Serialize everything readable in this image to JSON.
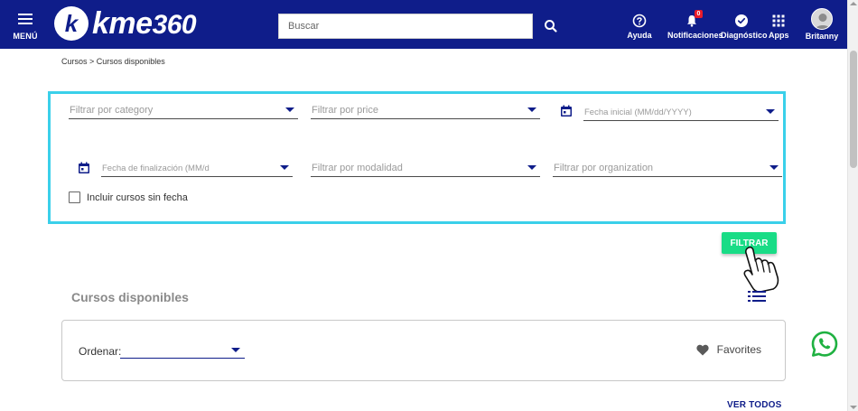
{
  "header": {
    "menu_label": "MENÚ",
    "logo_mark": "k",
    "logo_text": "kme",
    "logo_number": "360",
    "search_placeholder": "Buscar",
    "items": [
      {
        "label": "Ayuda",
        "icon": "help-icon"
      },
      {
        "label": "Notificaciones",
        "icon": "bell-icon",
        "badge": "0"
      },
      {
        "label": "Diagnóstico",
        "icon": "check-circle-icon"
      },
      {
        "label": "Apps",
        "icon": "grid-icon"
      },
      {
        "label": "Britanny",
        "icon": "avatar-icon"
      }
    ],
    "bg_color": "#0f1d8a"
  },
  "breadcrumb": "Cursos > Cursos disponibles",
  "filters": {
    "category_placeholder": "Filtrar por category",
    "price_placeholder": "Filtrar por price",
    "start_date_placeholder": "Fecha inicial (MM/dd/YYYY)",
    "end_date_placeholder": "Fecha de finalización (MM/d",
    "modality_placeholder": "Filtrar por modalidad",
    "organization_placeholder": "Filtrar por organization",
    "include_undated_label": "Incluir cursos sin fecha",
    "include_undated_checked": false,
    "border_color": "#3ad0ea"
  },
  "filter_button": {
    "label": "FILTRAR",
    "color": "#19dc86"
  },
  "section": {
    "title": "Cursos disponibles",
    "sort_label": "Ordenar:",
    "sort_value": "",
    "favorites_label": "Favorites"
  },
  "ver_todos": "VER TODOS",
  "accent_color": "#0f1d8a"
}
